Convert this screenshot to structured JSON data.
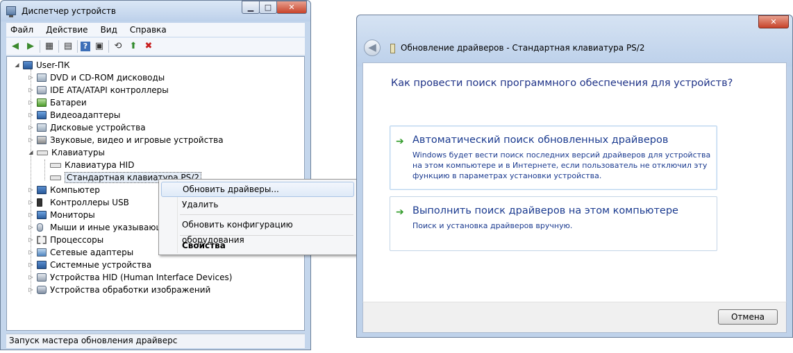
{
  "device_manager": {
    "title": "Диспетчер устройств",
    "window_buttons": {
      "minimize": "▁",
      "maximize": "□",
      "close": "✕"
    },
    "menu": [
      "Файл",
      "Действие",
      "Вид",
      "Справка"
    ],
    "toolbar_icons": [
      "back-icon",
      "forward-icon",
      "console-tree-icon",
      "properties-icon",
      "help-icon",
      "scan-hardware-icon",
      "update-driver-icon",
      "uninstall-icon"
    ],
    "tree": {
      "root": "User-ПК",
      "items": [
        {
          "label": "DVD и CD-ROM дисководы",
          "icon": "dvd-icon"
        },
        {
          "label": "IDE ATA/ATAPI контроллеры",
          "icon": "ide-controller-icon"
        },
        {
          "label": "Батареи",
          "icon": "battery-icon"
        },
        {
          "label": "Видеоадаптеры",
          "icon": "display-adapter-icon"
        },
        {
          "label": "Дисковые устройства",
          "icon": "disk-drive-icon"
        },
        {
          "label": "Звуковые, видео и игровые устройства",
          "icon": "sound-icon"
        },
        {
          "label": "Клавиатуры",
          "icon": "keyboard-icon",
          "expanded": true,
          "children": [
            "Клавиатура HID",
            "Стандартная клавиатура PS/2"
          ]
        },
        {
          "label": "Компьютер",
          "icon": "computer-icon"
        },
        {
          "label": "Контроллеры USB",
          "icon": "usb-icon"
        },
        {
          "label": "Мониторы",
          "icon": "monitor-icon"
        },
        {
          "label": "Мыши и иные указывающ",
          "icon": "mouse-icon"
        },
        {
          "label": "Процессоры",
          "icon": "processor-icon"
        },
        {
          "label": "Сетевые адаптеры",
          "icon": "network-icon"
        },
        {
          "label": "Системные устройства",
          "icon": "system-device-icon"
        },
        {
          "label": "Устройства HID (Human Interface Devices)",
          "icon": "hid-icon"
        },
        {
          "label": "Устройства обработки изображений",
          "icon": "imaging-icon"
        }
      ]
    },
    "status": "Запуск мастера обновления драйверс"
  },
  "context_menu": {
    "items": [
      {
        "label": "Обновить драйверы...",
        "hover": true
      },
      {
        "label": "Удалить"
      },
      {
        "label": "Обновить конфигурацию оборудования"
      },
      {
        "label": "Свойства",
        "bold": true
      }
    ]
  },
  "update_dialog": {
    "title": "Обновление драйверов - Стандартная клавиатура PS/2",
    "close": "✕",
    "back": "◀",
    "heading": "Как провести поиск программного обеспечения для устройств?",
    "options": [
      {
        "title": "Автоматический поиск обновленных драйверов",
        "description": "Windows будет вести поиск последних версий драйверов для устройства на этом компьютере и в Интернете, если пользователь не отключил эту функцию в параметрах установки устройства."
      },
      {
        "title": "Выполнить поиск драйверов на этом компьютере",
        "description": "Поиск и установка драйверов вручную."
      }
    ],
    "arrow": "➔",
    "cancel": "Отмена"
  }
}
